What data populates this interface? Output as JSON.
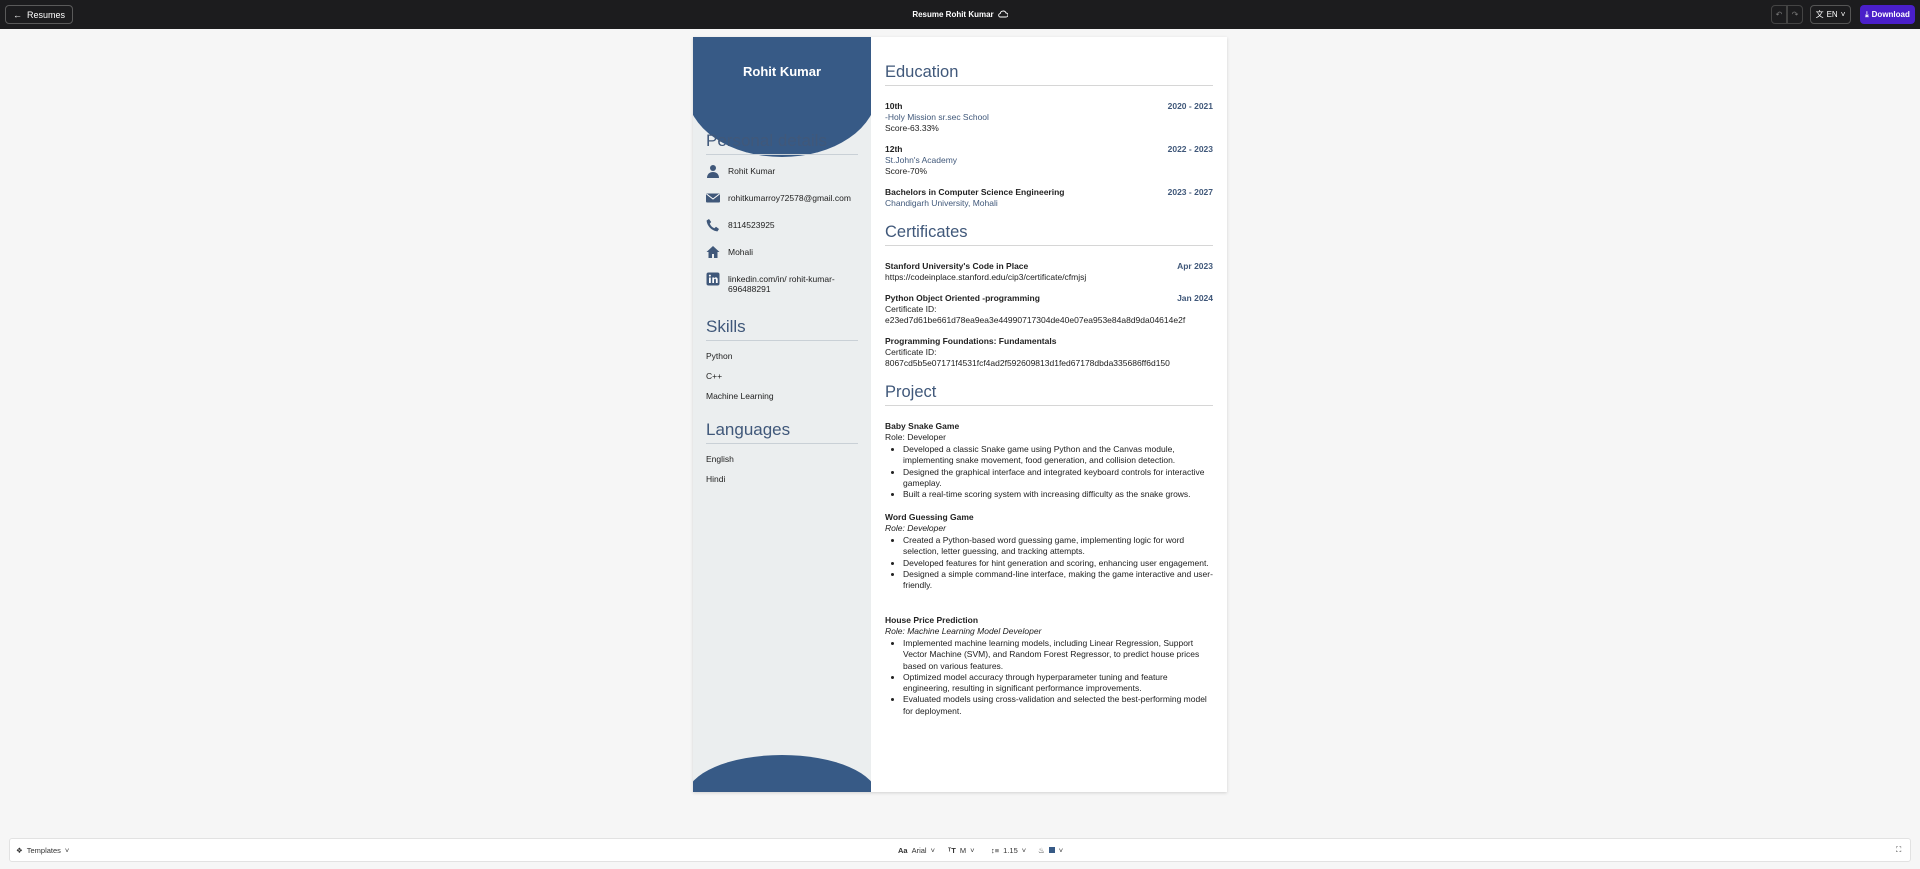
{
  "topbar": {
    "back_label": "Resumes",
    "title": "Resume Rohit Kumar",
    "lang": "EN",
    "download_label": "Download"
  },
  "resume": {
    "name": "Rohit Kumar",
    "personal": {
      "heading": "Personal details",
      "items": [
        {
          "icon": "user-icon",
          "text": "Rohit Kumar"
        },
        {
          "icon": "email-icon",
          "text": "rohitkumarroy72578@gmail.com"
        },
        {
          "icon": "phone-icon",
          "text": "8114523925"
        },
        {
          "icon": "home-icon",
          "text": "Mohali"
        },
        {
          "icon": "linkedin-icon",
          "text": "linkedin.com/in/ rohit-kumar-696488291"
        }
      ]
    },
    "skills": {
      "heading": "Skills",
      "items": [
        "Python",
        "C++",
        "Machine Learning"
      ]
    },
    "languages": {
      "heading": "Languages",
      "items": [
        "English",
        "Hindi"
      ]
    },
    "education": {
      "heading": "Education",
      "entries": [
        {
          "title": "10th",
          "date": "2020 - 2021",
          "school": "-Holy Mission sr.sec School",
          "score": "Score-63.33%"
        },
        {
          "title": "12th",
          "date": "2022 - 2023",
          "school": "St.John's Academy",
          "score": "Score-70%"
        },
        {
          "title": "Bachelors in Computer Science Engineering",
          "date": "2023 - 2027",
          "school": "Chandigarh University, Mohali",
          "score": ""
        }
      ]
    },
    "certificates": {
      "heading": "Certificates",
      "entries": [
        {
          "title": "Stanford University's Code in Place",
          "date": "Apr 2023",
          "line1": "https://codeinplace.stanford.edu/cip3/certificate/cfmjsj",
          "line2": ""
        },
        {
          "title": "Python Object Oriented -programming",
          "date": "Jan 2024",
          "line1": "Certificate ID:",
          "line2": "e23ed7d61be661d78ea9ea3e44990717304de40e07ea953e84a8d9da04614e2f"
        },
        {
          "title": "Programming Foundations: Fundamentals",
          "date": "",
          "line1": "Certificate ID:",
          "line2": "8067cd5b5e07171f4531fcf4ad2f592609813d1fed67178dbda335686ff6d150"
        }
      ]
    },
    "projects": {
      "heading": "Project",
      "entries": [
        {
          "title": "Baby Snake Game",
          "role": "Role: Developer",
          "bullets": [
            "Developed a classic Snake game using Python and the Canvas module, implementing snake movement, food generation, and collision detection.",
            "Designed the graphical interface and integrated keyboard controls for interactive gameplay.",
            "Built a real-time scoring system with increasing difficulty as the snake grows."
          ]
        },
        {
          "title": "Word Guessing Game",
          "role": "Role: Developer",
          "bullets": [
            "Created a Python-based word guessing game, implementing logic for word selection, letter guessing, and tracking attempts.",
            "Developed features for hint generation and scoring, enhancing user engagement.",
            "Designed a simple command-line interface, making the game interactive and user-friendly."
          ]
        },
        {
          "title": "House Price Prediction",
          "role": "Role: Machine Learning Model Developer",
          "bullets": [
            "Implemented machine learning models, including Linear Regression, Support Vector Machine (SVM), and Random Forest Regressor, to predict house prices based on various features.",
            "Optimized model accuracy through hyperparameter tuning and feature engineering, resulting in significant performance improvements.",
            "Evaluated models using cross-validation and selected the best-performing model for deployment."
          ]
        }
      ]
    }
  },
  "bottombar": {
    "templates_label": "Templates",
    "font_label": "Arial",
    "size_label": "M",
    "spacing_label": "1.15"
  },
  "colors": {
    "accent": "#375a86",
    "heading": "#40587a",
    "download": "#4a1fc9"
  }
}
